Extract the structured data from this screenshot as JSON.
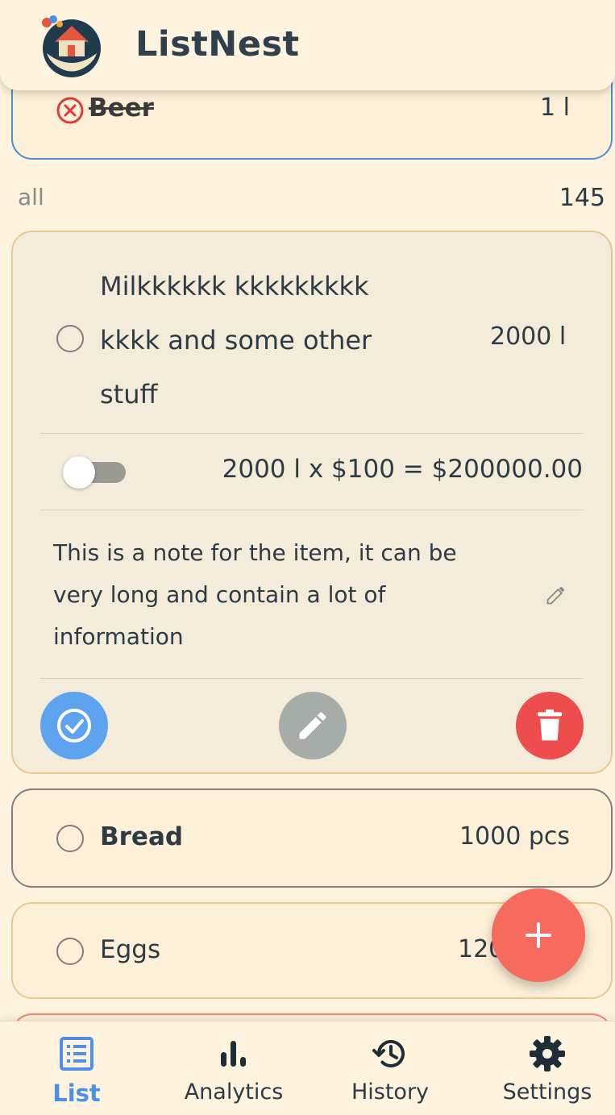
{
  "app": {
    "title": "ListNest"
  },
  "items": {
    "beer": {
      "name": "Beer",
      "quantity": "1 l"
    },
    "milk": {
      "name": "Milkkkkkk kkkkkkkkk kkkk and some other stuff",
      "quantity": "2000 l",
      "price_line": "2000 l x $100 = $200000.00",
      "note": "This is a note for the item, it can be very long and contain a lot of information"
    },
    "bread": {
      "name": "Bread",
      "quantity": "1000 pcs"
    },
    "eggs": {
      "name": "Eggs",
      "quantity": "120"
    }
  },
  "section": {
    "label": "all",
    "count": "145"
  },
  "nav": [
    {
      "label": "List",
      "icon": "list-icon",
      "active": true
    },
    {
      "label": "Analytics",
      "icon": "bar-chart-icon"
    },
    {
      "label": "History",
      "icon": "history-icon"
    },
    {
      "label": "Settings",
      "icon": "gear-icon"
    }
  ],
  "colors": {
    "background": "#fdf3df",
    "accent_blue": "#4f8fe8",
    "check_button": "#5ea3ef",
    "delete_button": "#ee4d4d",
    "fab": "#f76a5e"
  }
}
